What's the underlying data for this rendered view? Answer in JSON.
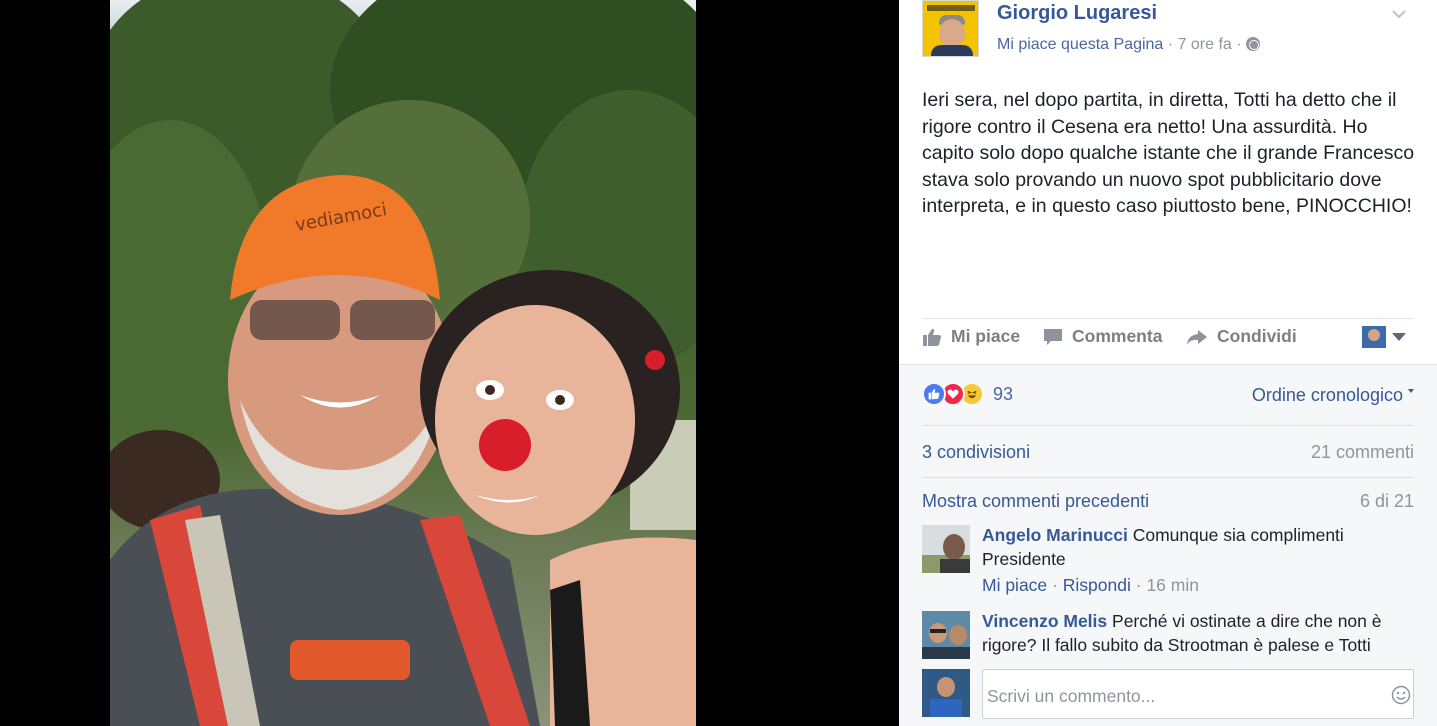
{
  "post": {
    "author": "Giorgio Lugaresi",
    "like_page": "Mi piace questa Pagina",
    "time": "7 ore fa",
    "dot": "·",
    "text": "Ieri sera, nel dopo partita, in diretta, Totti ha detto che il rigore contro il Cesena era netto! Una assurdità. Ho capito solo dopo qualche istante che il grande Francesco stava solo provando un nuovo spot pubblicitario dove interpreta, e in questo caso piuttosto bene, PINOCCHIO!",
    "cap_text": "vediamoci"
  },
  "actions": {
    "like": "Mi piace",
    "comment": "Commenta",
    "share": "Condividi"
  },
  "feedback": {
    "reactions": [
      "like",
      "love",
      "haha"
    ],
    "reaction_count": "93",
    "order": "Ordine cronologico",
    "shares": "3 condivisioni",
    "comments_count": "21 commenti",
    "show_previous": "Mostra commenti precedenti",
    "pager": "6 di 21"
  },
  "comments": [
    {
      "name": "Angelo Marinucci",
      "text": "Comunque sia complimenti Presidente",
      "like": "Mi piace",
      "reply": "Rispondi",
      "time": "16 min"
    },
    {
      "name": "Vincenzo Melis",
      "text": "Perché vi ostinate a dire che non è rigore? Il fallo subito da Strootman è palese e Totti"
    }
  ],
  "compose": {
    "placeholder": "Scrivi un commento..."
  },
  "colors": {
    "link": "#365899",
    "text": "#1d2129",
    "muted": "#90949c",
    "page_bg": "#000000"
  },
  "icons": [
    "chevron-down-icon",
    "globe-icon",
    "thumbs-up-icon",
    "comment-bubble-icon",
    "share-arrow-icon",
    "emoji-icon"
  ]
}
